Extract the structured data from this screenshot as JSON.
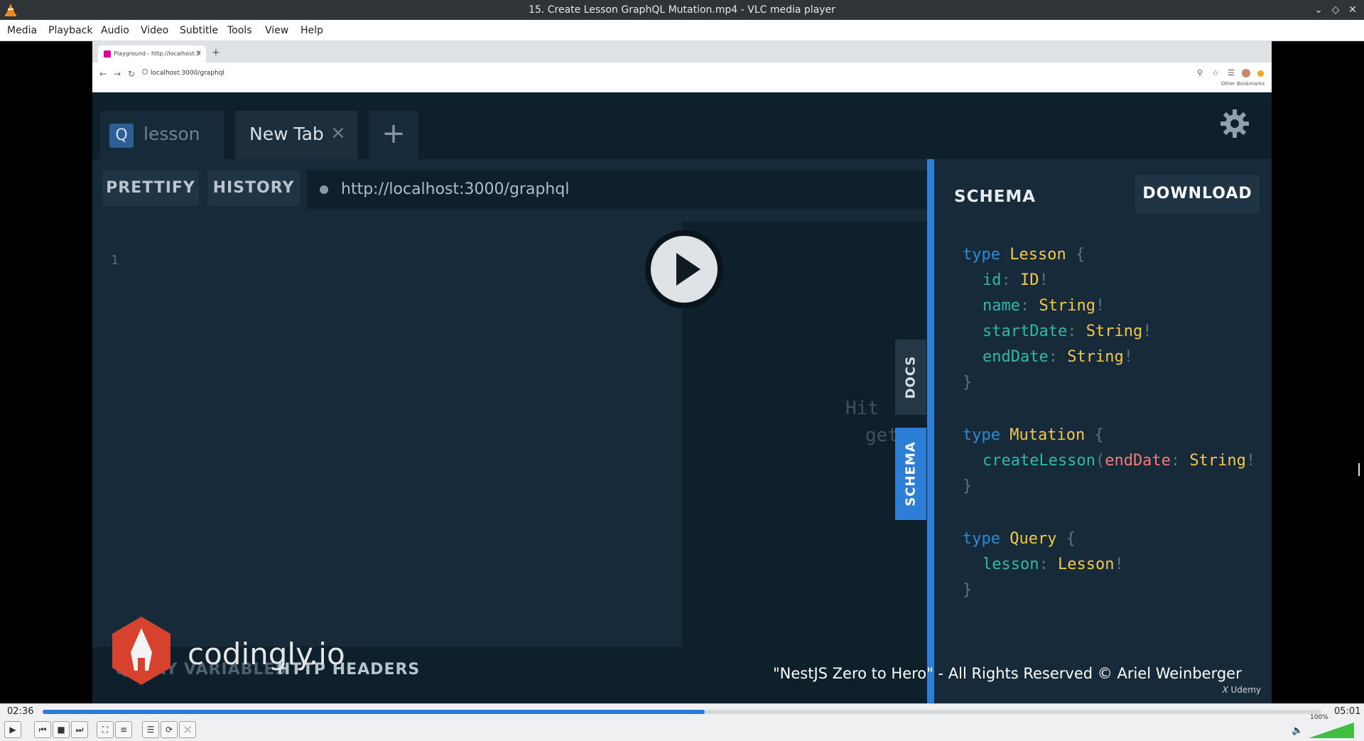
{
  "window": {
    "title": "15. Create Lesson GraphQL Mutation.mp4 - VLC media player",
    "minimize_glyph": "⌄",
    "restore_glyph": "◇",
    "close_glyph": "✕"
  },
  "menu": [
    "Media",
    "Playback",
    "Audio",
    "Video",
    "Subtitle",
    "Tools",
    "View",
    "Help"
  ],
  "browser": {
    "tab_title": "Playground - http://localhost:3",
    "tab_close": "×",
    "new_tab": "+",
    "back": "←",
    "forward": "→",
    "reload": "↻",
    "url": "localhost:3000/graphql",
    "bookmarks": "Other Bookmarks"
  },
  "playground": {
    "tabs": [
      {
        "badge": "Q",
        "label": "lesson"
      },
      {
        "label": "New Tab",
        "close": "×"
      }
    ],
    "add_tab": "+",
    "prettify": "PRETTIFY",
    "history": "HISTORY",
    "endpoint": "http://localhost:3000/graphql",
    "editor_line": "1",
    "hint_line1": "Hit",
    "hint_line2": "get",
    "docs_tab": "DOCS",
    "schema_tab": "SCHEMA",
    "query_variables": "QUERY VARIABLES",
    "http_headers": "HTTP HEADERS",
    "schema_title": "SCHEMA",
    "download": "DOWNLOAD",
    "schema_code": {
      "lesson_type": {
        "kw": "type",
        "name": "Lesson",
        "open": "{",
        "close": "}",
        "fields": [
          {
            "name": "id",
            "colon": ":",
            "type": "ID",
            "bang": "!"
          },
          {
            "name": "name",
            "colon": ":",
            "type": "String",
            "bang": "!"
          },
          {
            "name": "startDate",
            "colon": ":",
            "type": "String",
            "bang": "!"
          },
          {
            "name": "endDate",
            "colon": ":",
            "type": "String",
            "bang": "!"
          }
        ]
      },
      "mutation_type": {
        "kw": "type",
        "name": "Mutation",
        "open": "{",
        "close": "}",
        "field_name": "createLesson",
        "paren": "(",
        "arg_name": "endDate",
        "colon": ":",
        "arg_type": "String",
        "bang": "!"
      },
      "query_type": {
        "kw": "type",
        "name": "Query",
        "open": "{",
        "close": "}",
        "field_name": "lesson",
        "colon": ":",
        "field_type": "Lesson",
        "bang": "!"
      }
    }
  },
  "overlay": {
    "brand": "codingly.io",
    "copyright": "\"NestJS Zero to Hero\" - All Rights Reserved © Ariel Weinberger",
    "udemy": "Udemy"
  },
  "player": {
    "elapsed": "02:36",
    "total": "05:01",
    "progress": 0.518,
    "volume_label": "100%",
    "volume": 1.0,
    "accent": "#2e7bd6"
  }
}
